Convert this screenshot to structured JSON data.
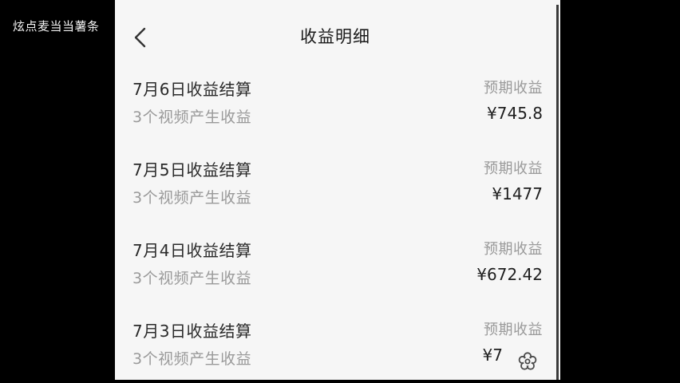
{
  "watermark": "炫点麦当当薯条",
  "header": {
    "title": "收益明细"
  },
  "rows": [
    {
      "title": "7月6日收益结算",
      "subtitle": "3个视频产生收益",
      "label": "预期收益",
      "amount": "¥745.8"
    },
    {
      "title": "7月5日收益结算",
      "subtitle": "3个视频产生收益",
      "label": "预期收益",
      "amount": "¥1477"
    },
    {
      "title": "7月4日收益结算",
      "subtitle": "3个视频产生收益",
      "label": "预期收益",
      "amount": "¥672.42"
    },
    {
      "title": "7月3日收益结算",
      "subtitle": "3个视频产生收益",
      "label": "预期收益",
      "amount": "¥7"
    }
  ],
  "icons": {
    "back": "chevron-left-icon",
    "overlay": "flower-gear-icon"
  }
}
